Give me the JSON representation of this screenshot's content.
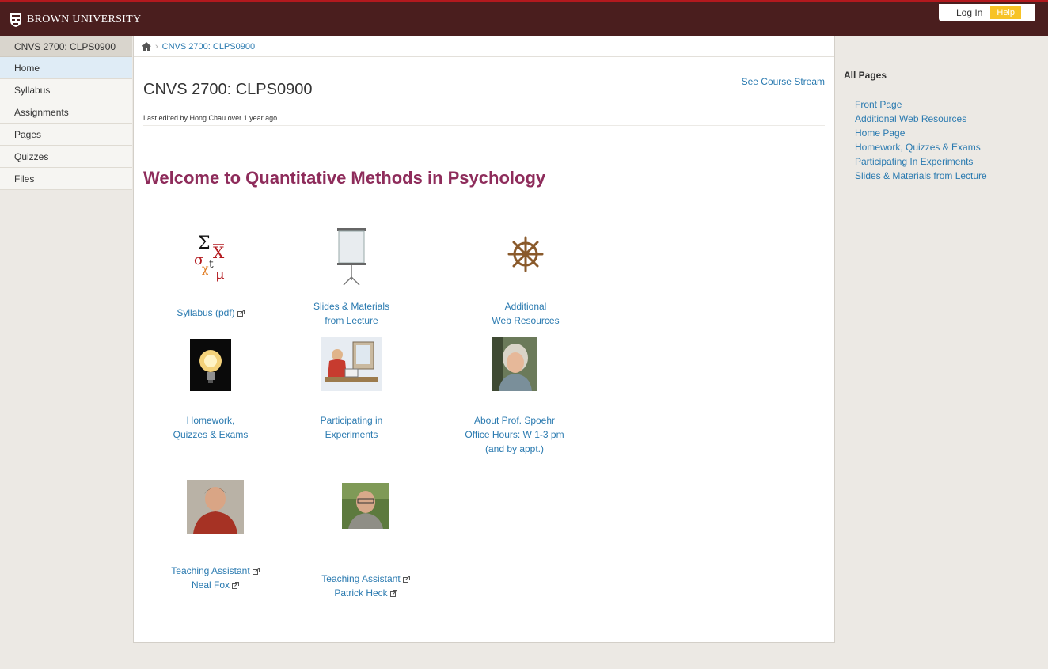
{
  "header": {
    "brand": "BROWN UNIVERSITY",
    "login": "Log In",
    "help": "Help"
  },
  "nav": {
    "course_title": "CNVS 2700: CLPS0900",
    "items": [
      "Home",
      "Syllabus",
      "Assignments",
      "Pages",
      "Quizzes",
      "Files"
    ],
    "active": "Home"
  },
  "breadcrumb": {
    "home_icon": "home-icon",
    "course": "CNVS 2700: CLPS0900"
  },
  "page": {
    "title": "CNVS 2700: CLPS0900",
    "see_stream": "See Course Stream",
    "last_edited": "Last edited by Hong Chau over 1 year ago",
    "welcome": "Welcome to Quantitative Methods in Psychology"
  },
  "tiles": {
    "syllabus": {
      "line1": "Syllabus (pdf)",
      "icon": "statistics-symbols-icon"
    },
    "slides": {
      "line1": "Slides & Materials",
      "line2": "from Lecture",
      "icon": "projector-screen-icon"
    },
    "resources": {
      "line1": "Additional",
      "line2": "Web Resources",
      "icon": "ship-wheel-icon"
    },
    "homework": {
      "line1": "Homework,",
      "line2": "Quizzes & Exams",
      "icon": "light-bulb-icon"
    },
    "experiments": {
      "line1": "Participating in",
      "line2": "Experiments",
      "icon": "person-at-desk-icon"
    },
    "prof": {
      "line1": "About Prof. Spoehr",
      "line2": "Office Hours: W 1-3 pm",
      "line3": "(and by appt.)",
      "icon": "professor-photo"
    },
    "ta1": {
      "line1": "Teaching Assistant",
      "line2": "Neal Fox",
      "icon": "ta-photo"
    },
    "ta2": {
      "line1": "Teaching Assistant",
      "line2": "Patrick Heck",
      "icon": "ta-photo"
    }
  },
  "all_pages": {
    "title": "All Pages",
    "items": [
      "Front Page",
      "Additional Web Resources",
      "Home Page",
      "Homework, Quizzes & Exams",
      "Participating In Experiments",
      "Slides & Materials from Lecture"
    ]
  },
  "colors": {
    "header_bg": "#4a1e1e",
    "header_accent": "#b3191e",
    "link": "#2a7ab0",
    "welcome": "#8e2c5b",
    "help_bg": "#f7c325"
  }
}
